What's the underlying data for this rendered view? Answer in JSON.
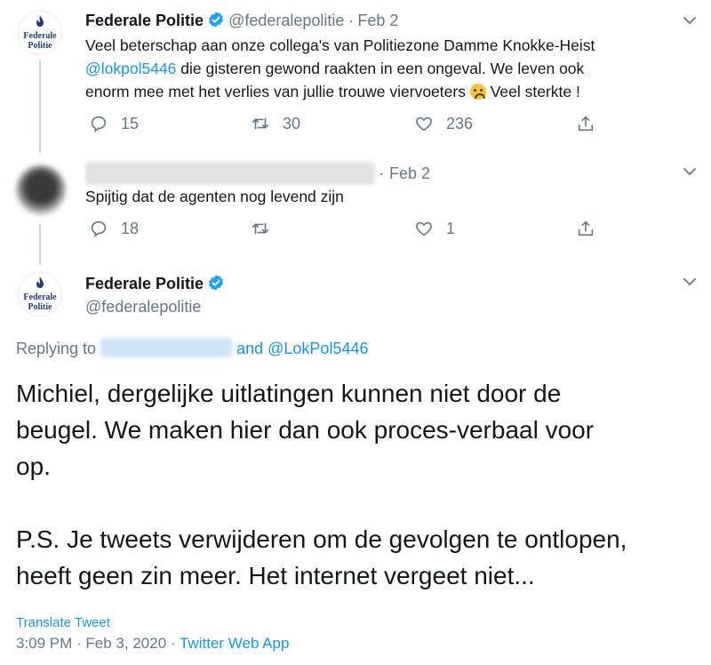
{
  "tweet1": {
    "name": "Federale Politie",
    "handle": "@federalepolitie",
    "dot": "·",
    "date": "Feb 2",
    "text_l1": "Veel beterschap aan onze collega's van Politiezone Damme Knokke-Heist",
    "mention": "@lokpol5446",
    "text_l2": " die gisteren gewond raakten in een ongeval. We leven ook",
    "text_l3a": "enorm mee met het verlies van jullie trouwe viervoeters ",
    "text_l3b": " Veel sterkte !",
    "replies": "15",
    "retweets": "30",
    "likes": "236"
  },
  "avatar": {
    "line1": "Federale",
    "line2": "Politie"
  },
  "tweet2": {
    "dot": "·",
    "date": "Feb 2",
    "text": "Spijtig dat de agenten nog levend zijn",
    "replies": "18",
    "likes": "1"
  },
  "main": {
    "name": "Federale Politie",
    "handle": "@federalepolitie",
    "replying_to": "Replying to",
    "and_mention": "and @LokPol5446",
    "text_p1_l1": "Michiel, dergelijke uitlatingen kunnen niet door de",
    "text_p1_l2": "beugel. We maken hier dan ook proces-verbaal voor",
    "text_p1_l3": "op.",
    "text_p2_l1": "P.S. Je tweets verwijderen om de gevolgen te ontlopen,",
    "text_p2_l2": "heeft geen zin meer. Het internet vergeet niet...",
    "translate": "Translate Tweet",
    "timestamp": "3:09 PM · Feb 3, 2020 ·",
    "source": "Twitter Web App"
  },
  "colors": {
    "accent": "#1b95e0",
    "muted": "#657786",
    "text": "#14171a",
    "brand": "#213c78"
  },
  "icons": [
    "reply-icon",
    "retweet-icon",
    "like-icon",
    "share-icon",
    "verified-badge-icon",
    "chevron-down-icon",
    "crying-face-emoji"
  ]
}
